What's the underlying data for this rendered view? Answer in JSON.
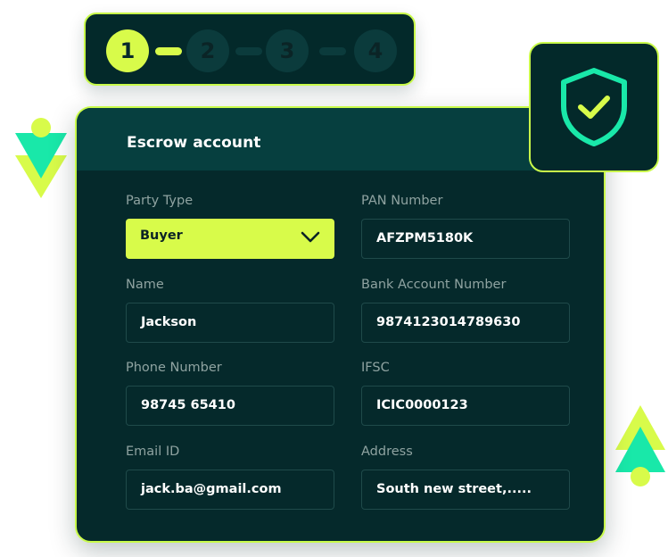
{
  "stepper": {
    "steps": [
      {
        "label": "1",
        "active": true
      },
      {
        "label": "2",
        "active": false
      },
      {
        "label": "3",
        "active": false
      },
      {
        "label": "4",
        "active": false
      }
    ]
  },
  "badge": {
    "icon": "shield-check-icon"
  },
  "card": {
    "title": "Escrow account",
    "fields": {
      "party_type": {
        "label": "Party Type",
        "value": "Buyer"
      },
      "pan_number": {
        "label": "PAN Number",
        "value": "AFZPM5180K"
      },
      "name": {
        "label": "Name",
        "value": "Jackson"
      },
      "bank_account": {
        "label": "Bank Account Number",
        "value": "9874123014789630"
      },
      "phone": {
        "label": "Phone Number",
        "value": "98745 65410"
      },
      "ifsc": {
        "label": "IFSC",
        "value": "ICIC0000123"
      },
      "email": {
        "label": "Email ID",
        "value": "jack.ba@gmail.com"
      },
      "address": {
        "label": "Address",
        "value": "South new street,....."
      }
    }
  },
  "colors": {
    "accent": "#d8fb4a",
    "panel": "#05292b",
    "header": "#063f3f",
    "teal": "#19e8a9",
    "label": "#8fa3a1"
  }
}
